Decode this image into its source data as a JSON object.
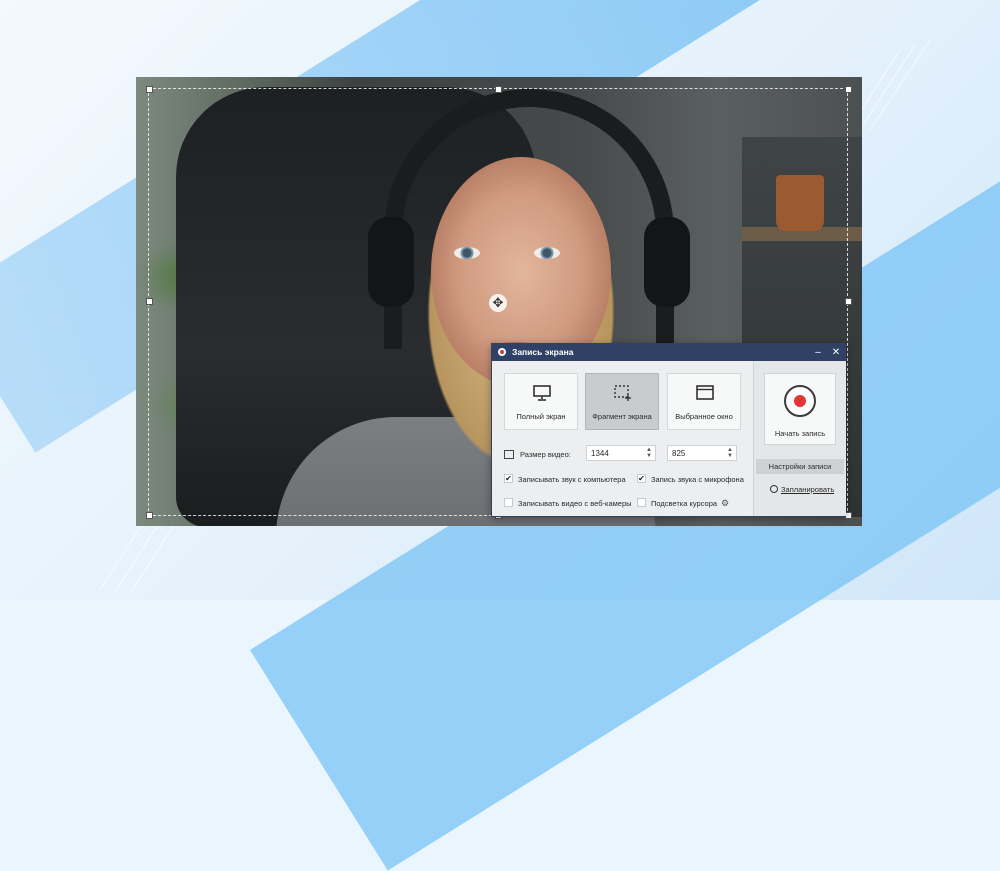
{
  "window": {
    "title": "Запись экрана",
    "minimize_glyph": "–",
    "close_glyph": "✕"
  },
  "modes": [
    {
      "label": "Полный экран",
      "icon": "monitor-icon",
      "active": false
    },
    {
      "label": "Фрагмент экрана",
      "icon": "region-select-icon",
      "active": true
    },
    {
      "label": "Выбранное окно",
      "icon": "window-icon",
      "active": false
    }
  ],
  "video_size": {
    "label": "Размер видео:",
    "width": "1344",
    "height": "825"
  },
  "options": {
    "computer_audio": {
      "label": "Записывать звук с компьютера",
      "checked": true
    },
    "mic_audio": {
      "label": "Запись звука с микрофона",
      "checked": true
    },
    "webcam": {
      "label": "Записывать видео с веб-камеры",
      "checked": false
    },
    "cursor_highlight": {
      "label": "Подсветка курсора",
      "checked": false
    }
  },
  "record": {
    "start_label": "Начать запись",
    "settings_label": "Настройки записи",
    "schedule_label": "Запланировать"
  },
  "colors": {
    "titlebar": "#2f4266",
    "record_dot": "#e53535",
    "background_accent": "#7cc3f3"
  }
}
